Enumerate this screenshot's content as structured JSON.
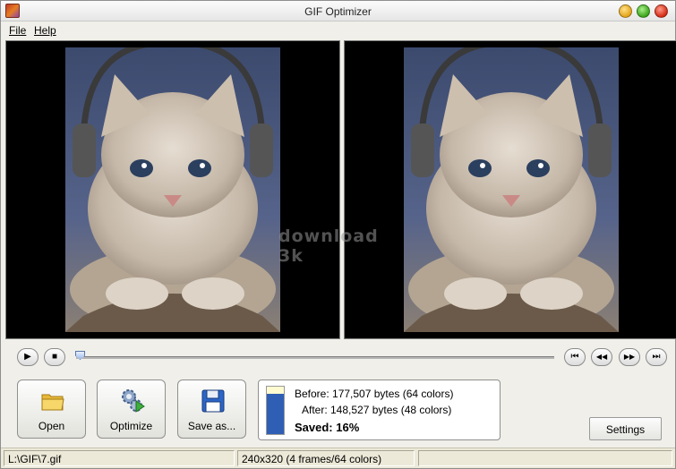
{
  "window": {
    "title": "GIF Optimizer"
  },
  "menu": {
    "file": "File",
    "help": "Help"
  },
  "preview": {
    "watermark": "download 3k"
  },
  "playback": {
    "play_glyph": "▶",
    "stop_glyph": "■",
    "first_glyph": "⏮",
    "prev_glyph": "◀◀",
    "next_glyph": "▶▶",
    "last_glyph": "⏭",
    "position_fraction": 0.0
  },
  "actions": {
    "open": "Open",
    "optimize": "Optimize",
    "save": "Save as..."
  },
  "stats": {
    "before": "Before: 177,507 bytes (64 colors)",
    "after": "After: 148,527 bytes (48 colors)",
    "saved": "Saved: 16%",
    "after_fraction": 0.84
  },
  "settings": {
    "label": "Settings"
  },
  "status": {
    "path": "L:\\GIF\\7.gif",
    "info": "240x320 (4 frames/64 colors)",
    "extra": ""
  },
  "icons": {
    "app": "app-icon",
    "open": "folder-icon",
    "optimize": "gears-play-icon",
    "save": "floppy-disk-icon"
  }
}
